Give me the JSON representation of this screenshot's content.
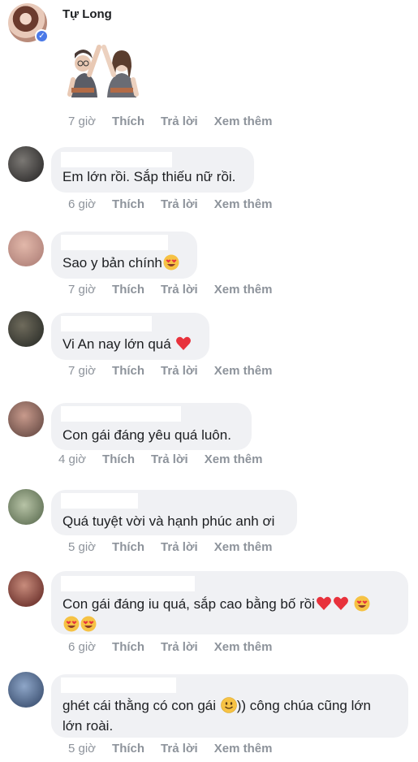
{
  "post": {
    "author": "Tự Long",
    "time": "7 giờ",
    "like": "Thích",
    "reply": "Trả lời",
    "more": "Xem thêm"
  },
  "comments": [
    {
      "text": "Em lớn rồi. Sắp thiếu nữ rồi.",
      "time": "6 giờ",
      "like": "Thích",
      "reply": "Trả lời",
      "more": "Xem thêm"
    },
    {
      "text": "Sao y bản chính",
      "time": "7 giờ",
      "like": "Thích",
      "reply": "Trả lời",
      "more": "Xem thêm",
      "emoji": "heart-eyes"
    },
    {
      "text": "Vi An nay lớn quá",
      "time": "7 giờ",
      "like": "Thích",
      "reply": "Trả lời",
      "more": "Xem thêm",
      "emoji": "red-heart"
    },
    {
      "text": "Con gái đáng yêu quá luôn.",
      "time": "4 giờ",
      "like": "Thích",
      "reply": "Trả lời",
      "more": "Xem thêm"
    },
    {
      "text": "Quá tuyệt vời và hạnh phúc anh ơi",
      "time": "5 giờ",
      "like": "Thích",
      "reply": "Trả lời",
      "more": "Xem thêm"
    },
    {
      "text_line1": "Con gái đáng iu quá, sắp cao bằng bố rồi",
      "time": "6 giờ",
      "like": "Thích",
      "reply": "Trả lời",
      "more": "Xem thêm"
    },
    {
      "text_line1_a": "ghét cái thằng có con gái",
      "text_line1_b": ")) công chúa cũng lớn",
      "text_line2": "lớn roài.",
      "time": "5 giờ",
      "like": "Thích",
      "reply": "Trả lời",
      "more": "Xem thêm"
    }
  ],
  "colors": {
    "bubble": "#f0f1f4",
    "meta": "#8d939b",
    "verified": "#4a79e8",
    "heart": "#e8323c"
  }
}
